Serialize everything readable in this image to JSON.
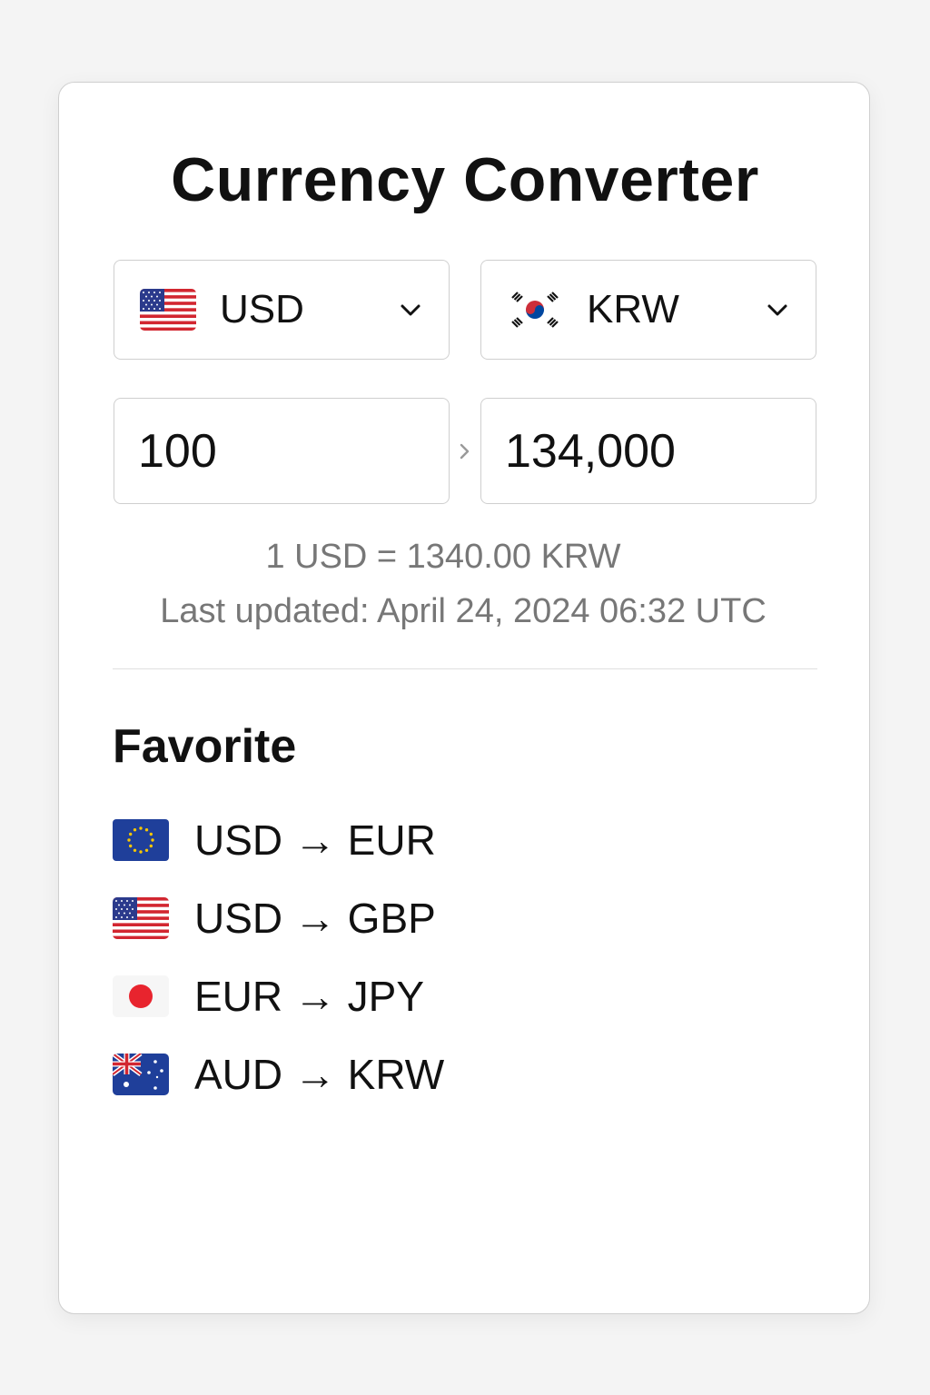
{
  "title": "Currency Converter",
  "from_currency": {
    "code": "USD",
    "flag_icon": "us-flag-icon"
  },
  "to_currency": {
    "code": "KRW",
    "flag_icon": "kr-flag-icon"
  },
  "amount_input": "100",
  "converted_amount": "134,000",
  "rate_text": "1 USD = 1340.00 KRW",
  "last_updated": "Last updated: April 24, 2024 06:32 UTC",
  "favorites_title": "Favorite",
  "favorites": [
    {
      "from": "USD",
      "to": "EUR",
      "label": "USD → EUR",
      "flag_icon": "eu-flag-icon"
    },
    {
      "from": "USD",
      "to": "GBP",
      "label": "USD → GBP",
      "flag_icon": "us-flag-icon"
    },
    {
      "from": "EUR",
      "to": "JPY",
      "label": "EUR → JPY",
      "flag_icon": "jp-flag-icon"
    },
    {
      "from": "AUD",
      "to": "KRW",
      "label": "AUD → KRW",
      "flag_icon": "au-flag-icon"
    }
  ],
  "colors": {
    "text": "#111111",
    "muted_text": "#777777",
    "border": "#cfcfcf",
    "background": "#f4f4f4"
  }
}
